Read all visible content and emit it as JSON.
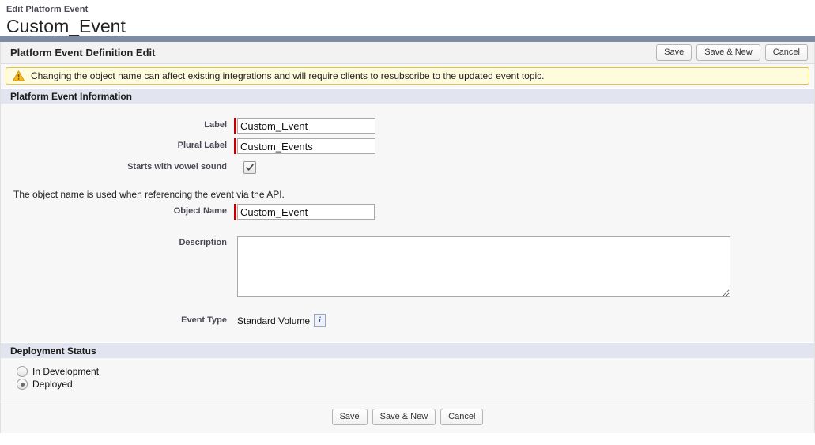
{
  "header": {
    "eyebrow": "Edit Platform Event",
    "title": "Custom_Event"
  },
  "panel": {
    "title": "Platform Event Definition Edit",
    "buttons": {
      "save": "Save",
      "save_new": "Save & New",
      "cancel": "Cancel"
    }
  },
  "warning": {
    "icon": "warning-triangle-icon",
    "message": "Changing the object name can affect existing integrations and will require clients to resubscribe to the updated event topic."
  },
  "sections": {
    "information": {
      "band_title": "Platform Event Information",
      "fields": {
        "label": {
          "label": "Label",
          "value": "Custom_Event",
          "required": true
        },
        "plural_label": {
          "label": "Plural Label",
          "value": "Custom_Events",
          "required": true
        },
        "vowel": {
          "label": "Starts with vowel sound",
          "checked": true,
          "glyph": "✔"
        },
        "api_hint": "The object name is used when referencing the event via the API.",
        "object_name": {
          "label": "Object Name",
          "value": "Custom_Event",
          "required": true
        },
        "description": {
          "label": "Description",
          "value": "",
          "placeholder": ""
        },
        "event_type": {
          "label": "Event Type",
          "value": "Standard Volume",
          "info_icon": "info-icon",
          "info_glyph": "i"
        }
      }
    },
    "deployment": {
      "band_title": "Deployment Status",
      "options": [
        {
          "label": "In Development",
          "selected": false
        },
        {
          "label": "Deployed",
          "selected": true
        }
      ]
    }
  },
  "footer": {
    "buttons": {
      "save": "Save",
      "save_new": "Save & New",
      "cancel": "Cancel"
    }
  },
  "colors": {
    "rule": "#7f8ca5",
    "band": "#e2e5ef",
    "warning_bg": "#fffcdd",
    "warning_border": "#e3c23c",
    "required_marker": "#c00000"
  }
}
